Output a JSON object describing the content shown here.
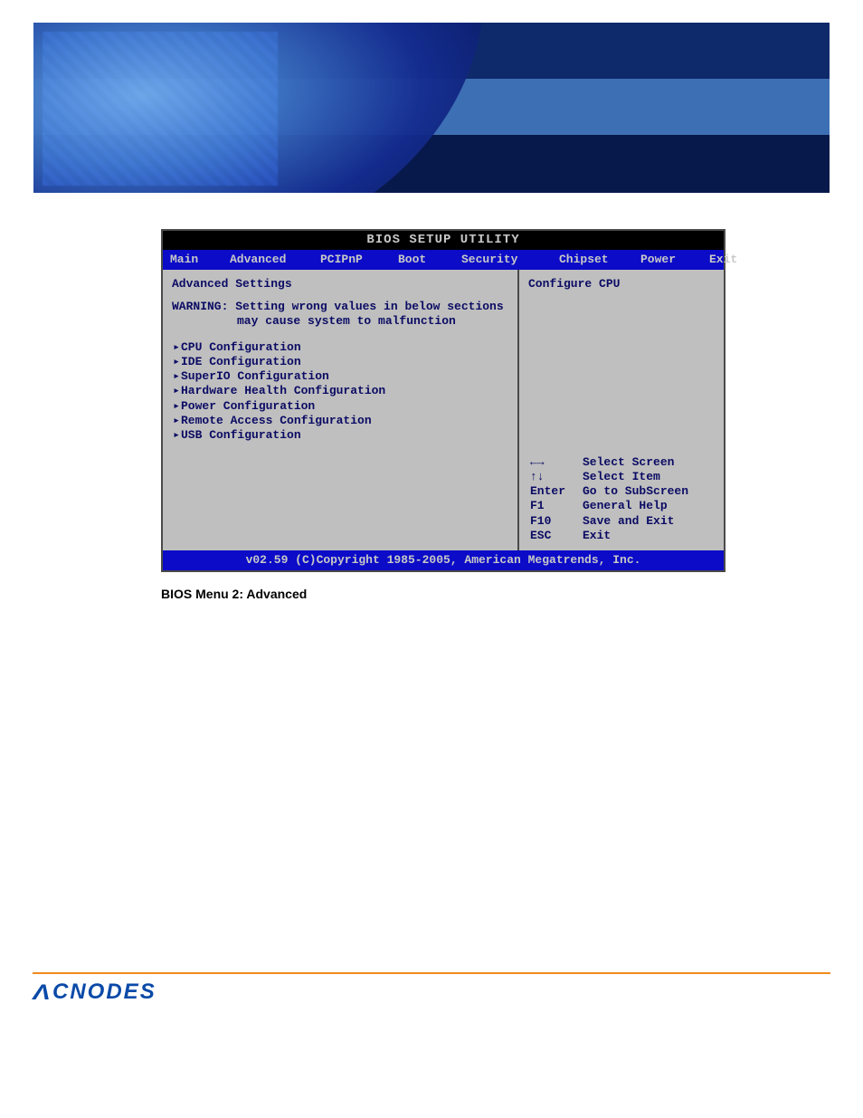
{
  "bios": {
    "title": "BIOS SETUP UTILITY",
    "tabs": [
      "Main",
      "Advanced",
      "PCIPnP",
      "Boot",
      "Security",
      "Chipset",
      "Power",
      "Exit"
    ],
    "section_title": "Advanced Settings",
    "warning_l1": "WARNING: Setting wrong values in below sections",
    "warning_l2": "may cause system to malfunction",
    "menu_items": [
      "CPU Configuration",
      "IDE Configuration",
      "SuperIO Configuration",
      "Hardware Health Configuration",
      "Power Configuration",
      "Remote Access Configuration",
      "USB Configuration"
    ],
    "help_text": "Configure CPU",
    "keys": [
      {
        "key": "←→",
        "action": "Select Screen"
      },
      {
        "key": "↑↓",
        "action": "Select Item"
      },
      {
        "key": "Enter",
        "action": "Go to SubScreen"
      },
      {
        "key": "F1",
        "action": "General Help"
      },
      {
        "key": "F10",
        "action": "Save and Exit"
      },
      {
        "key": "ESC",
        "action": "Exit"
      }
    ],
    "footer": "v02.59 (C)Copyright 1985-2005, American Megatrends, Inc."
  },
  "caption": "BIOS Menu 2: Advanced",
  "brand": "CNODES"
}
